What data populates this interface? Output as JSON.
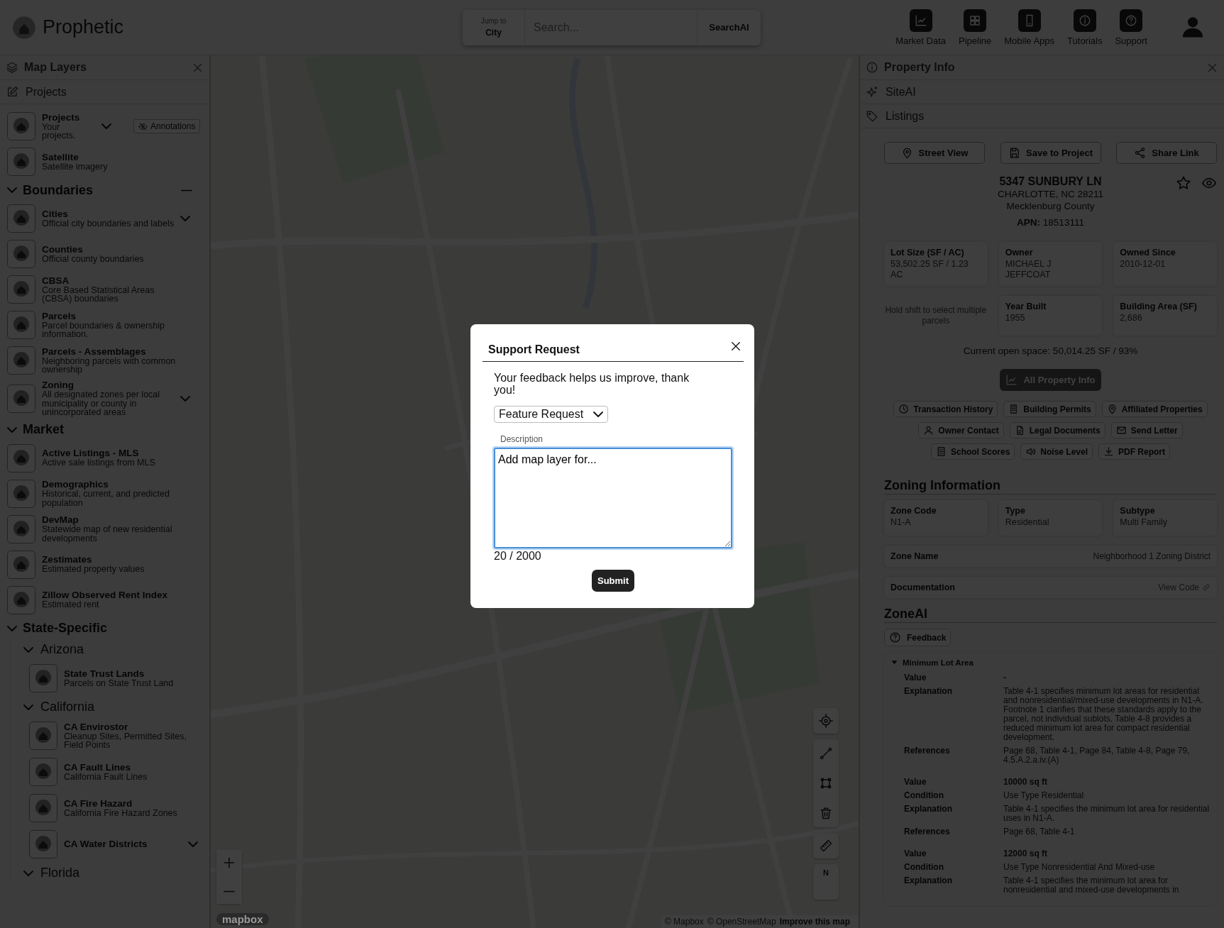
{
  "header": {
    "brand": "Prophetic",
    "jump_label": "Jump to",
    "jump_value": "City",
    "search_placeholder": "Search...",
    "search_button": "SearchAI",
    "nav": [
      "Market Data",
      "Pipeline",
      "Mobile Apps",
      "Tutorials",
      "Support"
    ]
  },
  "layers_panel": {
    "title": "Map Layers",
    "tab": "Projects",
    "top_items": [
      {
        "title": "Projects",
        "description": "Your projects.",
        "has_menu": true,
        "annotations_button": "Annotations"
      },
      {
        "title": "Satellite",
        "description": "Satellite imagery",
        "has_menu": false
      }
    ],
    "sections": [
      {
        "title": "Boundaries",
        "expanded": true,
        "collapse_all": true,
        "items": [
          {
            "title": "Cities",
            "description": "Official city boundaries and labels",
            "has_menu": true
          },
          {
            "title": "Counties",
            "description": "Official county boundaries",
            "has_menu": false
          },
          {
            "title": "CBSA",
            "description": "Core Based Statistical Areas (CBSA) boundaries",
            "has_menu": false
          },
          {
            "title": "Parcels",
            "description": "Parcel boundaries & ownership information.",
            "has_menu": false
          },
          {
            "title": "Parcels - Assemblages",
            "description": "Neighboring parcels with common ownership",
            "has_menu": false
          },
          {
            "title": "Zoning",
            "description": "All designated zones per local municipality or county in unincorporated areas",
            "has_menu": true
          }
        ]
      },
      {
        "title": "Market",
        "expanded": true,
        "collapse_all": false,
        "items": [
          {
            "title": "Active Listings - MLS",
            "description": "Active sale listings from MLS",
            "has_menu": false
          },
          {
            "title": "Demographics",
            "description": "Historical, current, and predicted population",
            "has_menu": false
          },
          {
            "title": "DevMap",
            "description": "Statewide map of new residential developments",
            "has_menu": false
          },
          {
            "title": "Zestimates",
            "description": "Estimated property values",
            "has_menu": false
          },
          {
            "title": "Zillow Observed Rent Index",
            "description": "Estimated rent",
            "has_menu": false
          }
        ]
      },
      {
        "title": "State-Specific",
        "expanded": true,
        "collapse_all": false,
        "children": [
          {
            "title": "Arizona",
            "expanded": true,
            "items": [
              {
                "title": "State Trust Lands",
                "description": "Parcels on State Trust Land",
                "has_menu": false
              }
            ]
          },
          {
            "title": "California",
            "expanded": true,
            "items": [
              {
                "title": "CA Envirostor",
                "description": "Cleanup Sites, Permitted Sites, Field Points",
                "has_menu": false
              },
              {
                "title": "CA Fault Lines",
                "description": "California Fault Lines",
                "has_menu": false
              },
              {
                "title": "CA Fire Hazard",
                "description": "California Fire Hazard Zones",
                "has_menu": false
              },
              {
                "title": "CA Water Districts",
                "has_menu": true
              }
            ]
          },
          {
            "title": "Florida",
            "expanded": true
          }
        ]
      }
    ]
  },
  "map": {
    "logo": "mapbox",
    "compass_label": "N",
    "attribution": [
      "© Mapbox",
      "© OpenStreetMap"
    ],
    "improve_link": "Improve this map"
  },
  "property_panel": {
    "title": "Property Info",
    "sections": [
      "SiteAI",
      "Listings"
    ],
    "actions": [
      "Street View",
      "Save to Project",
      "Share Link"
    ],
    "address": "5347 SUNBURY LN",
    "city": "CHARLOTTE, NC 28211",
    "county": "Mecklenburg County",
    "apn": "**APN:** 18513111",
    "favorited": false,
    "facts": [
      {
        "kind": "fact",
        "label": "Lot Size (SF / AC)",
        "value": "53,502.25 SF / 1.23 AC"
      },
      {
        "kind": "fact",
        "label": "Owner",
        "value": "MICHAEL J JEFFCOAT"
      },
      {
        "kind": "fact",
        "label": "Owned Since",
        "value": "2010-12-01"
      },
      {
        "kind": "hint",
        "text": "Hold shift to select multiple parcels"
      },
      {
        "kind": "fact",
        "label": "Year Built",
        "value": "1955"
      },
      {
        "kind": "fact",
        "label": "Building Area (SF)",
        "value": "2,686"
      }
    ],
    "open_space": "Current open space: 50,014.25 SF / 93%",
    "all_info_button": "All Property Info",
    "chip_rows": [
      [
        "Transaction History",
        "Building Permits",
        "Affiliated Properties"
      ],
      [
        "Owner Contact",
        "Legal Documents",
        "Send Letter"
      ],
      [
        "School Scores",
        "Noise Level",
        "PDF Report"
      ]
    ],
    "zoning_title": "Zoning Information",
    "zoning_cards": [
      {
        "label": "Zone Code",
        "value": "N1-A"
      },
      {
        "label": "Type",
        "value": "Residential"
      },
      {
        "label": "Subtype",
        "value": "Multi Family"
      }
    ],
    "zone_name": {
      "label": "Zone Name",
      "value": "Neighborhood 1 Zoning District"
    },
    "documentation": {
      "label": "Documentation",
      "link": "View Code"
    },
    "zoneai_title": "ZoneAI",
    "feedback_button": "Feedback",
    "accordion": {
      "title": "Minimum Lot Area",
      "expanded": true,
      "groups": [
        [
          {
            "kind": "value",
            "label": "Value",
            "value": "-"
          },
          {
            "kind": "text",
            "label": "Explanation",
            "value": "Table 4-1 specifies minimum lot areas for residential and nonresidential/mixed-use developments in N1-A. Footnote 1 clarifies that these standards apply to the parcel, not individual sublots. Table 4-8 provides a reduced minimum lot area for compact residential development."
          },
          {
            "kind": "text",
            "label": "References",
            "value": "Page 68, Table 4-1, Page 84, Table 4-8, Page 79, 4.5.A.2.a.iv.(A)"
          }
        ],
        [
          {
            "kind": "value",
            "label": "Value",
            "value": "10000 sq ft"
          },
          {
            "kind": "text",
            "label": "Condition",
            "value": "Use Type Residential"
          },
          {
            "kind": "text",
            "label": "Explanation",
            "value": "Table 4-1 specifies the minimum lot area for residential uses in N1-A."
          },
          {
            "kind": "text",
            "label": "References",
            "value": "Page 68, Table 4-1"
          }
        ],
        [
          {
            "kind": "value",
            "label": "Value",
            "value": "12000 sq ft"
          },
          {
            "kind": "text",
            "label": "Condition",
            "value": "Use Type Nonresidential And Mixed-use"
          },
          {
            "kind": "text",
            "label": "Explanation",
            "value": "Table 4-1 specifies the minimum lot area for nonresidential and mixed-use developments in"
          }
        ]
      ]
    }
  },
  "modal": {
    "title": "Support Request",
    "message": "Your feedback helps us improve, thank you!",
    "request_type": "Feature Request",
    "description_label": "Description",
    "description_value": "Add map layer for...",
    "focused": true,
    "counter": "20 / 2000",
    "submit": "Submit"
  }
}
